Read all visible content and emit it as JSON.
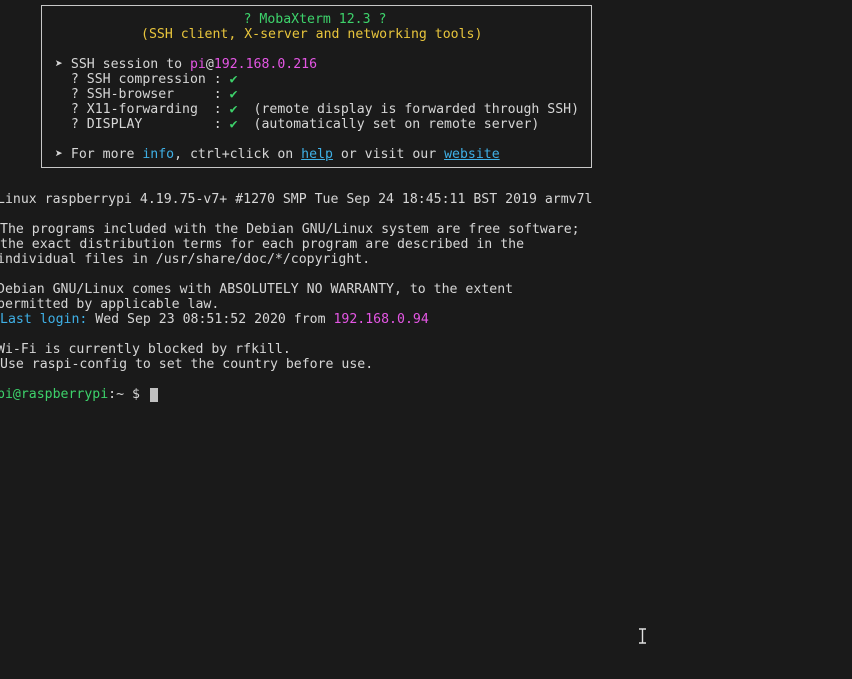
{
  "banner": {
    "title": "? MobaXterm 12.3 ?",
    "subtitle": "(SSH client, X-server and networking tools)",
    "session_prefix": "➤ SSH session to ",
    "session_user": "pi",
    "session_at": "@",
    "session_host": "192.168.0.216",
    "rows": [
      {
        "label": "  ? SSH compression : ",
        "check": "✔",
        "note": ""
      },
      {
        "label": "  ? SSH-browser     : ",
        "check": "✔",
        "note": ""
      },
      {
        "label": "  ? X11-forwarding  : ",
        "check": "✔",
        "note": "  (remote display is forwarded through SSH)"
      },
      {
        "label": "  ? DISPLAY         : ",
        "check": "✔",
        "note": "  (automatically set on remote server)"
      }
    ],
    "more_prefix": "➤ For more ",
    "more_info": "info",
    "more_mid": ", ctrl+click on ",
    "more_help": "help",
    "more_or": " or visit our ",
    "more_website": "website"
  },
  "terminal": {
    "uname": "Linux raspberrypi 4.19.75-v7+ #1270 SMP Tue Sep 24 18:45:11 BST 2019 armv7l",
    "motd1": "The programs included with the Debian GNU/Linux system are free software;",
    "motd2": "the exact distribution terms for each program are described in the",
    "motd3": "individual files in /usr/share/doc/*/copyright.",
    "motd4": "Debian GNU/Linux comes with ABSOLUTELY NO WARRANTY, to the extent",
    "motd5": "permitted by applicable law.",
    "last_login_label": "Last login:",
    "last_login_text": " Wed Sep 23 08:51:52 2020 from ",
    "last_login_ip": "192.168.0.94",
    "wifi1": "Wi-Fi is currently blocked by rfkill.",
    "wifi2": "Use raspi-config to set the country before use.",
    "prompt_user": "pi@raspberrypi",
    "prompt_rest": ":~ $ "
  }
}
